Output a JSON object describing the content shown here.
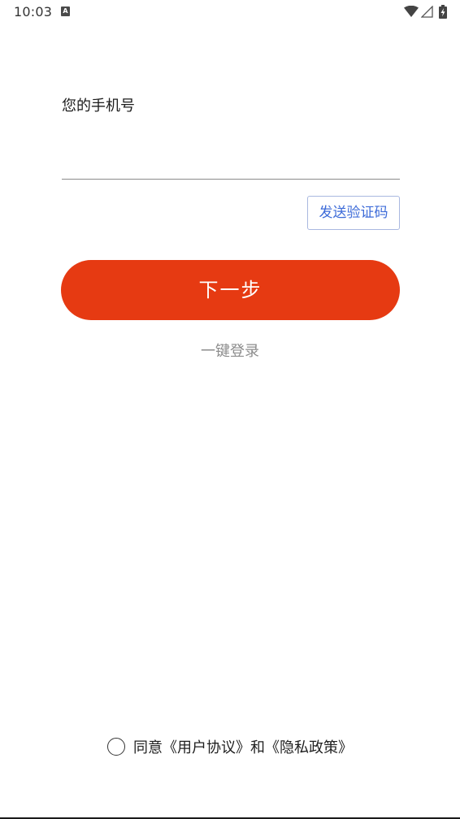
{
  "status_bar": {
    "time": "10:03",
    "notification_icon": "keyboard-icon",
    "notification_glyph": "A",
    "wifi_icon": "wifi-icon",
    "signal_icon": "signal-icon",
    "battery_icon": "battery-charging-icon"
  },
  "form": {
    "phone_label": "您的手机号",
    "phone_value": "",
    "phone_placeholder": "",
    "send_code_label": "发送验证码",
    "next_label": "下一步",
    "one_click_login_label": "一键登录"
  },
  "agreement": {
    "checked": false,
    "agree_text": "同意",
    "user_agreement_link": "《用户协议》",
    "and_text": "和",
    "privacy_policy_link": "《隐私政策》"
  },
  "colors": {
    "primary_button": "#e63a12",
    "link_blue": "#3d6bd8",
    "muted_text": "#8c8c8c"
  }
}
